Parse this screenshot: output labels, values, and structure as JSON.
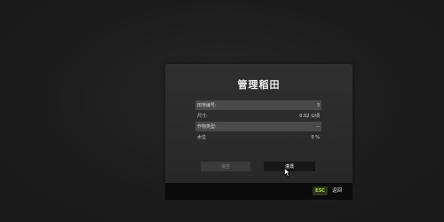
{
  "dialog": {
    "title": "管理稻田",
    "fields": {
      "field_id": {
        "label": "田地编号:",
        "value": "3"
      },
      "size": {
        "label": "尺寸:",
        "value": "0.02 公顷"
      },
      "crop_type": {
        "label": "作物类型:",
        "value": "--"
      },
      "water": {
        "label": "水位",
        "value": "0 %"
      }
    },
    "clear_button": "清空",
    "plant_button": "灌溉"
  },
  "footer": {
    "esc_key": "ESC",
    "back_label": "返回"
  }
}
